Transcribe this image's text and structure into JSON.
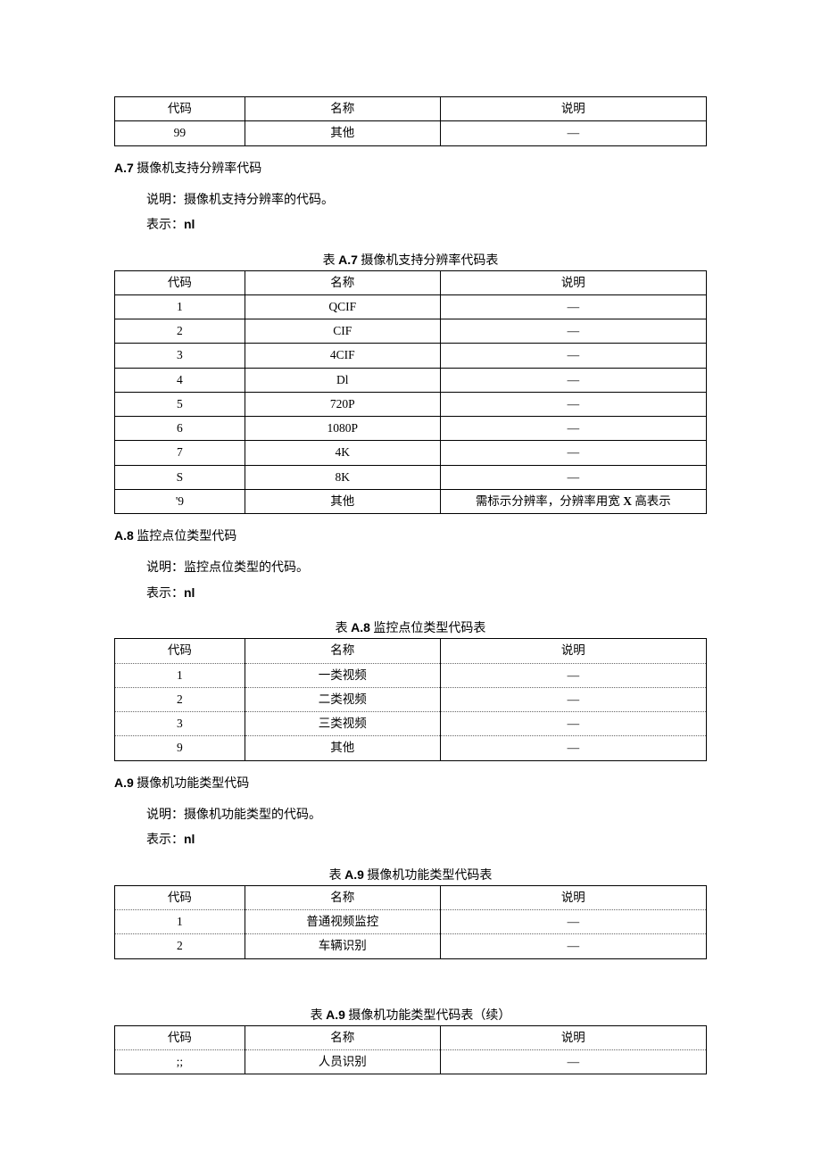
{
  "headers": {
    "code": "代码",
    "name": "名称",
    "desc": "说明"
  },
  "dash": "—",
  "dash2": "—",
  "topTable": {
    "row": {
      "code": "99",
      "name": "其他",
      "desc": "—"
    }
  },
  "secA7": {
    "num": "A.7",
    "title": "摄像机支持分辨率代码",
    "desc": "说明：摄像机支持分辨率的代码。",
    "rep_lbl": "表示：",
    "rep_val": "nl",
    "caption_pre": "表 ",
    "caption_num": "A.7",
    "caption_post": " 摄像机支持分辨率代码表",
    "rows": [
      {
        "code": "1",
        "name": "QCIF",
        "desc": "—"
      },
      {
        "code": "2",
        "name": "CIF",
        "desc": "—"
      },
      {
        "code": "3",
        "name": "4CIF",
        "desc": "—"
      },
      {
        "code": "4",
        "name": "Dl",
        "desc": "—"
      },
      {
        "code": "5",
        "name": "720P",
        "desc": "—"
      },
      {
        "code": "6",
        "name": "1080P",
        "desc": "—"
      },
      {
        "code": "7",
        "name": "4K",
        "desc": "—"
      },
      {
        "code": "S",
        "name": "8K",
        "desc": "—"
      },
      {
        "code": "'9",
        "name": "其他",
        "desc_pre": "需标示分辨率，分辨率用宽 ",
        "desc_b": "X",
        "desc_post": " 高表示"
      }
    ]
  },
  "secA8": {
    "num": "A.8",
    "title": "监控点位类型代码",
    "desc": "说明：监控点位类型的代码。",
    "rep_lbl": "表示：",
    "rep_val": "nl",
    "caption_pre": "表 ",
    "caption_num": "A.8",
    "caption_post": " 监控点位类型代码表",
    "rows": [
      {
        "code": "1",
        "name": "一类视频",
        "desc": "—"
      },
      {
        "code": "2",
        "name": "二类视频",
        "desc": "—"
      },
      {
        "code": "3",
        "name": "三类视频",
        "desc": "—"
      },
      {
        "code": "9",
        "name": "其他",
        "desc": "—"
      }
    ]
  },
  "secA9": {
    "num": "A.9",
    "title": "摄像机功能类型代码",
    "desc": "说明：摄像机功能类型的代码。",
    "rep_lbl": "表示：",
    "rep_val": "nl",
    "caption_pre": "表 ",
    "caption_num": "A.9",
    "caption_post": " 摄像机功能类型代码表",
    "rows": [
      {
        "code": "1",
        "name": "普通视频监控",
        "desc": "—"
      },
      {
        "code": "2",
        "name": "车辆识别",
        "desc": "—"
      }
    ],
    "cont_caption_pre": "表 ",
    "cont_caption_num": "A.9",
    "cont_caption_post": " 摄像机功能类型代码表（续）",
    "cont_rows": [
      {
        "code": ";;",
        "name": "人员识别",
        "desc": "—"
      }
    ]
  }
}
